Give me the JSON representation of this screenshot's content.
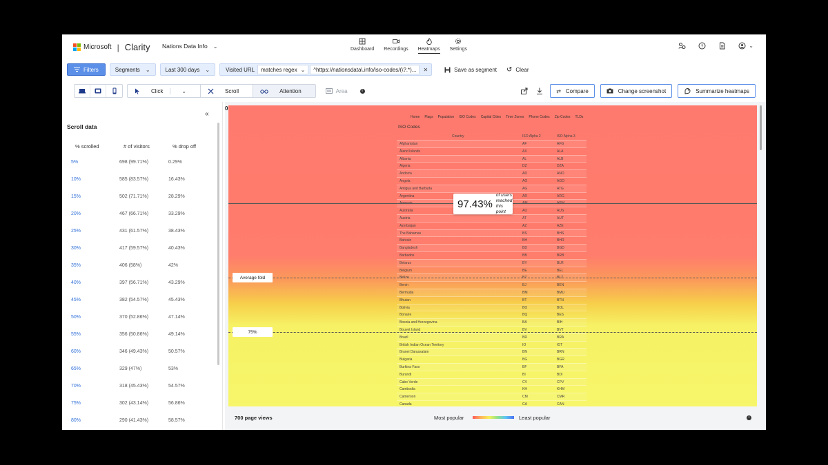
{
  "topbar": {
    "brand": "Microsoft",
    "product": "Clarity",
    "project": "Nations Data Info",
    "nav": [
      {
        "label": "Dashboard",
        "icon": "dashboard-icon"
      },
      {
        "label": "Recordings",
        "icon": "video-icon"
      },
      {
        "label": "Heatmaps",
        "icon": "flame-icon",
        "active": true
      },
      {
        "label": "Settings",
        "icon": "gear-icon"
      }
    ],
    "right_icons": [
      "team-icon",
      "help-icon",
      "document-icon",
      "user-account-icon"
    ]
  },
  "filters": {
    "filters_label": "Filters",
    "segments_label": "Segments",
    "date_range": "Last 300 days",
    "url_filter": {
      "field": "Visited URL",
      "operator": "matches regex",
      "value": "^https://nationsdata\\.info/iso-codes/(\\?.*)..."
    },
    "save_segment": "Save as segment",
    "clear": "Clear"
  },
  "toolbar": {
    "modes": [
      "Click",
      "Scroll",
      "Attention"
    ],
    "active_mode": "Scroll",
    "area": "Area",
    "compare": "Compare",
    "change_screenshot": "Change screenshot",
    "summarize": "Summarize heatmaps"
  },
  "scroll_panel": {
    "title": "Scroll data",
    "headers": [
      "% scrolled",
      "# of visitors",
      "% drop off"
    ],
    "rows": [
      [
        "5%",
        "698 (99.71%)",
        "0.29%"
      ],
      [
        "10%",
        "585 (83.57%)",
        "16.43%"
      ],
      [
        "15%",
        "502 (71.71%)",
        "28.29%"
      ],
      [
        "20%",
        "467 (66.71%)",
        "33.29%"
      ],
      [
        "25%",
        "431 (61.57%)",
        "38.43%"
      ],
      [
        "30%",
        "417 (59.57%)",
        "40.43%"
      ],
      [
        "35%",
        "406 (58%)",
        "42%"
      ],
      [
        "40%",
        "397 (56.71%)",
        "43.29%"
      ],
      [
        "45%",
        "382 (54.57%)",
        "45.43%"
      ],
      [
        "50%",
        "370 (52.86%)",
        "47.14%"
      ],
      [
        "55%",
        "356 (50.86%)",
        "49.14%"
      ],
      [
        "60%",
        "346 (49.43%)",
        "50.57%"
      ],
      [
        "65%",
        "329 (47%)",
        "53%"
      ],
      [
        "70%",
        "318 (45.43%)",
        "54.57%"
      ],
      [
        "75%",
        "302 (43.14%)",
        "56.86%"
      ],
      [
        "80%",
        "290 (41.43%)",
        "58.57%"
      ]
    ]
  },
  "heatmap": {
    "zero_label": "0",
    "callout_value": "97.43%",
    "callout_text": "of users reached this point",
    "average_fold": "Average fold",
    "marker_75": "75%",
    "page": {
      "menu": [
        "Home",
        "Flags",
        "Population",
        "ISO Codes",
        "Capital Cities",
        "Time Zones",
        "Phone Codes",
        "Zip Codes",
        "TLDs"
      ],
      "title": "ISO Codes",
      "headers": [
        "Country",
        "ISO Alpha 2",
        "ISO Alpha 3"
      ],
      "rows": [
        [
          "Afghanistan",
          "AF",
          "AFG"
        ],
        [
          "Åland Islands",
          "AX",
          "ALA"
        ],
        [
          "Albania",
          "AL",
          "ALB"
        ],
        [
          "Algeria",
          "DZ",
          "DZA"
        ],
        [
          "Andorra",
          "AD",
          "AND"
        ],
        [
          "Angola",
          "AO",
          "AGO"
        ],
        [
          "Antigua and Barbuda",
          "AG",
          "ATG"
        ],
        [
          "Argentina",
          "AR",
          "ARG"
        ],
        [
          "Armenia",
          "AM",
          "ARM"
        ],
        [
          "Australia",
          "AU",
          "AUS"
        ],
        [
          "Austria",
          "AT",
          "AUT"
        ],
        [
          "Azerbaijan",
          "AZ",
          "AZE"
        ],
        [
          "The Bahamas",
          "BS",
          "BHS"
        ],
        [
          "Bahrain",
          "BH",
          "BHR"
        ],
        [
          "Bangladesh",
          "BD",
          "BGD"
        ],
        [
          "Barbados",
          "BB",
          "BRB"
        ],
        [
          "Belarus",
          "BY",
          "BLR"
        ],
        [
          "Belgium",
          "BE",
          "BEL"
        ],
        [
          "Belize",
          "BZ",
          "BLZ"
        ],
        [
          "Benin",
          "BJ",
          "BEN"
        ],
        [
          "Bermuda",
          "BM",
          "BMU"
        ],
        [
          "Bhutan",
          "BT",
          "BTN"
        ],
        [
          "Bolivia",
          "BO",
          "BOL"
        ],
        [
          "Bonaire",
          "BQ",
          "BES"
        ],
        [
          "Bosnia and Herzegovina",
          "BA",
          "BIH"
        ],
        [
          "Bouvet Island",
          "BV",
          "BVT"
        ],
        [
          "Brazil",
          "BR",
          "BRA"
        ],
        [
          "British Indian Ocean Territory",
          "IO",
          "IOT"
        ],
        [
          "Brunei Darussalam",
          "BN",
          "BRN"
        ],
        [
          "Bulgaria",
          "BG",
          "BGR"
        ],
        [
          "Burkina Faso",
          "BF",
          "BFA"
        ],
        [
          "Burundi",
          "BI",
          "BDI"
        ],
        [
          "Cabo Verde",
          "CV",
          "CPV"
        ],
        [
          "Cambodia",
          "KH",
          "KHM"
        ],
        [
          "Cameroon",
          "CM",
          "CMR"
        ],
        [
          "Canada",
          "CA",
          "CAN"
        ]
      ]
    }
  },
  "legend": {
    "page_views": "700 page views",
    "most_popular": "Most popular",
    "least_popular": "Least popular"
  },
  "colors": {
    "accent": "#5b8fe8",
    "link": "#2f6fd8",
    "heat_top": "#ff7a6e",
    "heat_bottom": "#f7f66a"
  }
}
